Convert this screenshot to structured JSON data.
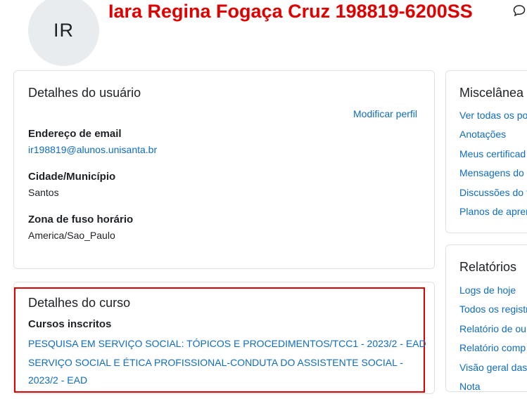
{
  "header": {
    "avatar_initials": "IR",
    "user_name": "Iara Regina Fogaça Cruz 198819-6200SS"
  },
  "user_details": {
    "title": "Detalhes do usuário",
    "edit_link": "Modificar perfil",
    "fields": [
      {
        "label": "Endereço de email",
        "value": "ir198819@alunos.unisanta.br"
      },
      {
        "label": "Cidade/Município",
        "value": "Santos"
      },
      {
        "label": "Zona de fuso horário",
        "value": "America/Sao_Paulo"
      }
    ]
  },
  "course_details": {
    "title": "Detalhes do curso",
    "enrolled_label": "Cursos inscritos",
    "courses": [
      "PESQUISA EM SERVIÇO SOCIAL: TÓPICOS E PROCEDIMENTOS/TCC1 - 2023/2 - EAD",
      "SERVIÇO SOCIAL E ÉTICA PROFISSIONAL-CONDUTA DO ASSISTENTE SOCIAL - 2023/2 - EAD"
    ]
  },
  "misc": {
    "title": "Miscelânea",
    "items": [
      "Ver todas os po",
      "Anotações",
      "Meus certificad",
      "Mensagens do",
      "Discussões do f",
      "Planos de aprer"
    ]
  },
  "reports": {
    "title": "Relatórios",
    "items": [
      "Logs de hoje",
      "Todos os registr",
      "Relatório de ou",
      "Relatório comp",
      "Visão geral das",
      "Nota"
    ]
  },
  "colors": {
    "accent_link": "#0f6cbf",
    "title_red": "#e00000",
    "border": "#dee2e6"
  }
}
